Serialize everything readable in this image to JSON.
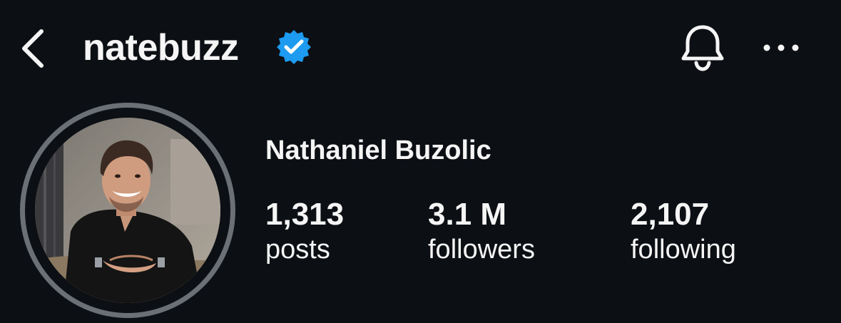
{
  "header": {
    "username": "natebuzz",
    "verified": true,
    "icons": {
      "back": "chevron-left-icon",
      "verified": "verified-badge-icon",
      "notifications": "bell-icon",
      "more": "more-horizontal-icon"
    }
  },
  "profile": {
    "full_name": "Nathaniel Buzolic",
    "avatar": "profile-photo"
  },
  "stats": {
    "posts": {
      "value": "1,313",
      "label": "posts"
    },
    "followers": {
      "value": "3.1 M",
      "label": "followers"
    },
    "following": {
      "value": "2,107",
      "label": "following"
    }
  },
  "colors": {
    "background": "#0c0f14",
    "text": "#f5f5f5",
    "verified": "#1d9bf0",
    "avatar_ring": "#6b6f76"
  }
}
